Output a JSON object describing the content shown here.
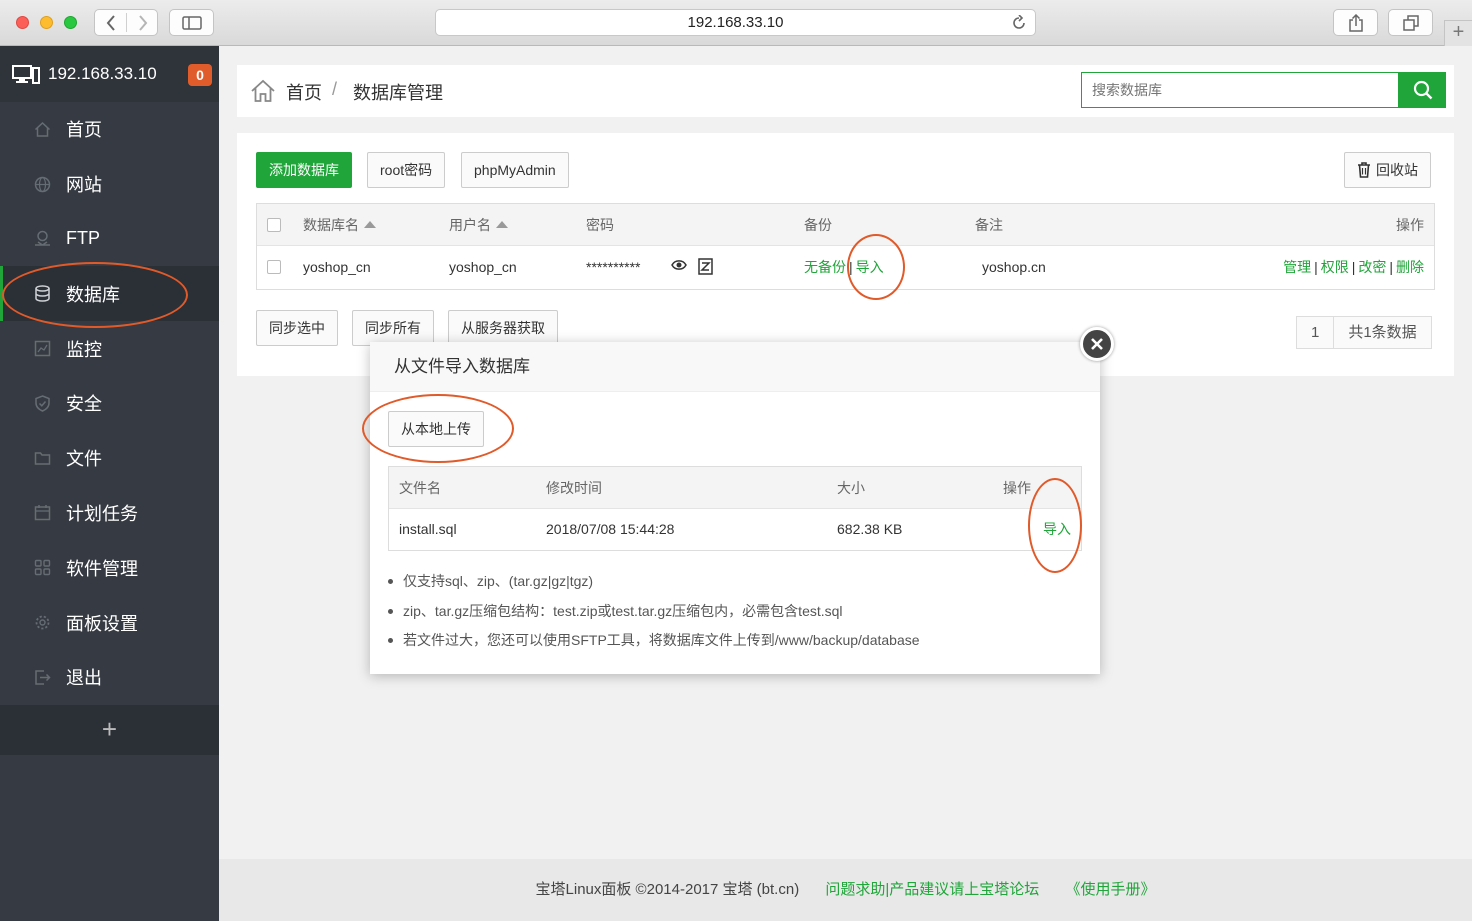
{
  "browser": {
    "address": "192.168.33.10"
  },
  "sidebar": {
    "server": "192.168.33.10",
    "notice_count": "0",
    "items": [
      {
        "label": "首页",
        "icon": "home-icon"
      },
      {
        "label": "网站",
        "icon": "globe-icon"
      },
      {
        "label": "FTP",
        "icon": "ftp-icon"
      },
      {
        "label": "数据库",
        "icon": "database-icon",
        "active": true
      },
      {
        "label": "监控",
        "icon": "monitor-icon"
      },
      {
        "label": "安全",
        "icon": "shield-icon"
      },
      {
        "label": "文件",
        "icon": "folder-icon"
      },
      {
        "label": "计划任务",
        "icon": "calendar-icon"
      },
      {
        "label": "软件管理",
        "icon": "grid-icon"
      },
      {
        "label": "面板设置",
        "icon": "gear-icon"
      },
      {
        "label": "退出",
        "icon": "logout-icon"
      }
    ],
    "add_label": "+"
  },
  "breadcrumb": {
    "home": "首页",
    "sep": "/",
    "current": "数据库管理"
  },
  "search": {
    "placeholder": "搜索数据库"
  },
  "toolbar": {
    "add_db": "添加数据库",
    "root_pwd": "root密码",
    "phpmyadmin": "phpMyAdmin",
    "recycle": "回收站"
  },
  "db_table": {
    "headers": {
      "name": "数据库名",
      "user": "用户名",
      "password": "密码",
      "backup": "备份",
      "note": "备注",
      "ops": "操作"
    },
    "rows": [
      {
        "name": "yoshop_cn",
        "user": "yoshop_cn",
        "password": "**********",
        "backup_none": "无备份",
        "backup_import": "导入",
        "note": "yoshop.cn",
        "ops": [
          "管理",
          "权限",
          "改密",
          "删除"
        ]
      }
    ]
  },
  "actions": {
    "sync_selected": "同步选中",
    "sync_all": "同步所有",
    "fetch_from_server": "从服务器获取"
  },
  "pager": {
    "page": "1",
    "total": "共1条数据"
  },
  "footer": {
    "copyright": "宝塔Linux面板 ©2014-2017 宝塔 (bt.cn)",
    "forum": "问题求助|产品建议请上宝塔论坛",
    "manual": "《使用手册》"
  },
  "modal": {
    "title": "从文件导入数据库",
    "upload": "从本地上传",
    "headers": {
      "file": "文件名",
      "mtime": "修改时间",
      "size": "大小",
      "ops": "操作"
    },
    "files": [
      {
        "file": "install.sql",
        "mtime": "2018/07/08 15:44:28",
        "size": "682.38 KB",
        "op": "导入"
      }
    ],
    "tips": [
      "仅支持sql、zip、(tar.gz|gz|tgz)",
      "zip、tar.gz压缩包结构：test.zip或test.tar.gz压缩包内，必需包含test.sql",
      "若文件过大，您还可以使用SFTP工具，将数据库文件上传到/www/backup/database"
    ]
  },
  "colors": {
    "accent": "#20a53a",
    "sidebar": "#363b43",
    "annotation": "#e05a2a"
  }
}
